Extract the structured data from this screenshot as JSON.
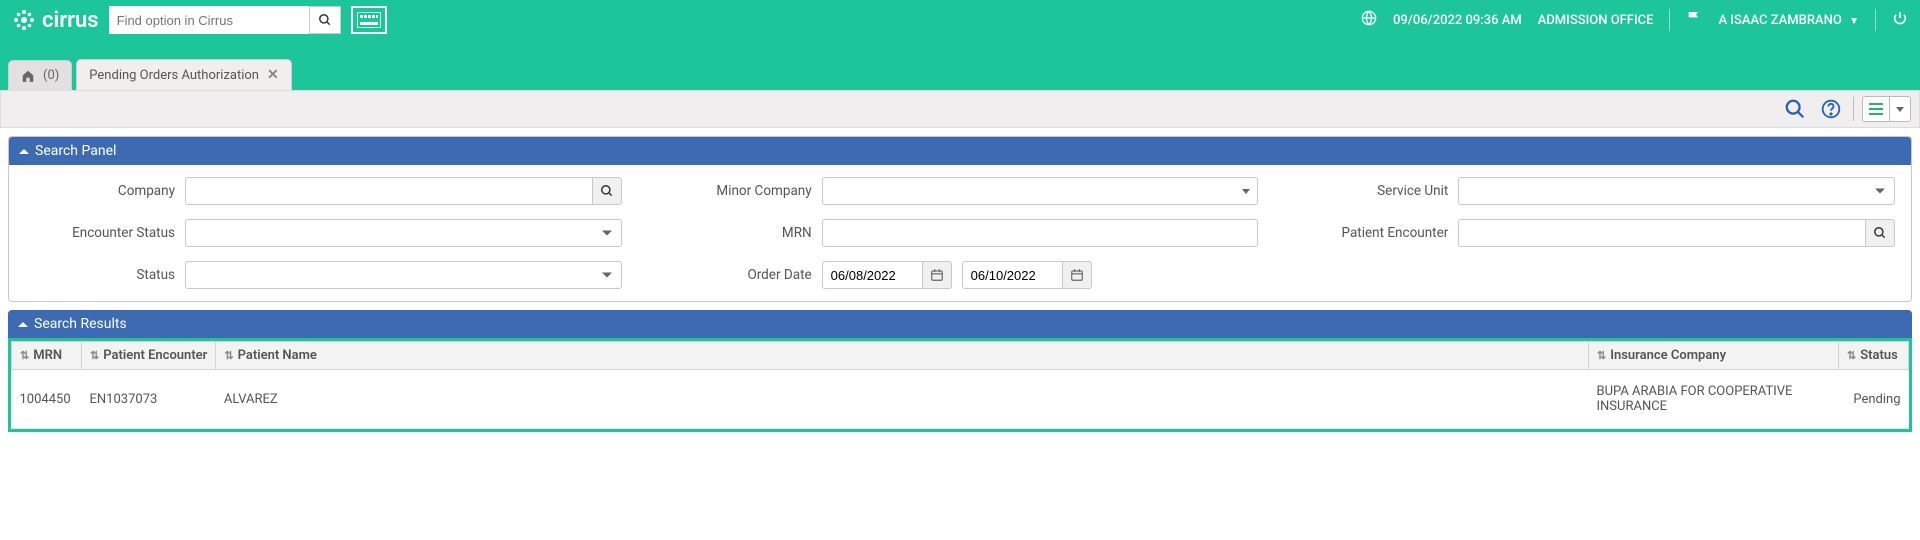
{
  "brand": {
    "name": "cirrus"
  },
  "top_search": {
    "placeholder": "Find option in Cirrus"
  },
  "top_right": {
    "datetime": "09/06/2022 09:36 AM",
    "location": "ADMISSION OFFICE",
    "user": "A ISAAC ZAMBRANO"
  },
  "tabs": {
    "home_count": "(0)",
    "active": "Pending Orders Authorization"
  },
  "search_panel": {
    "title": "Search Panel",
    "fields": {
      "company": "Company",
      "minor_company": "Minor Company",
      "service_unit": "Service Unit",
      "encounter_status": "Encounter Status",
      "mrn": "MRN",
      "patient_encounter": "Patient Encounter",
      "status": "Status",
      "order_date": "Order Date"
    },
    "values": {
      "order_date_from": "06/08/2022",
      "order_date_to": "06/10/2022"
    }
  },
  "results_panel": {
    "title": "Search Results",
    "columns": {
      "mrn": "MRN",
      "patient_encounter": "Patient Encounter",
      "patient_name": "Patient Name",
      "insurance_company": "Insurance Company",
      "status": "Status"
    },
    "rows": [
      {
        "mrn": "1004450",
        "patient_encounter": "EN1037073",
        "patient_name": "ALVAREZ",
        "insurance_company": "BUPA ARABIA FOR COOPERATIVE INSURANCE",
        "status": "Pending"
      }
    ]
  }
}
